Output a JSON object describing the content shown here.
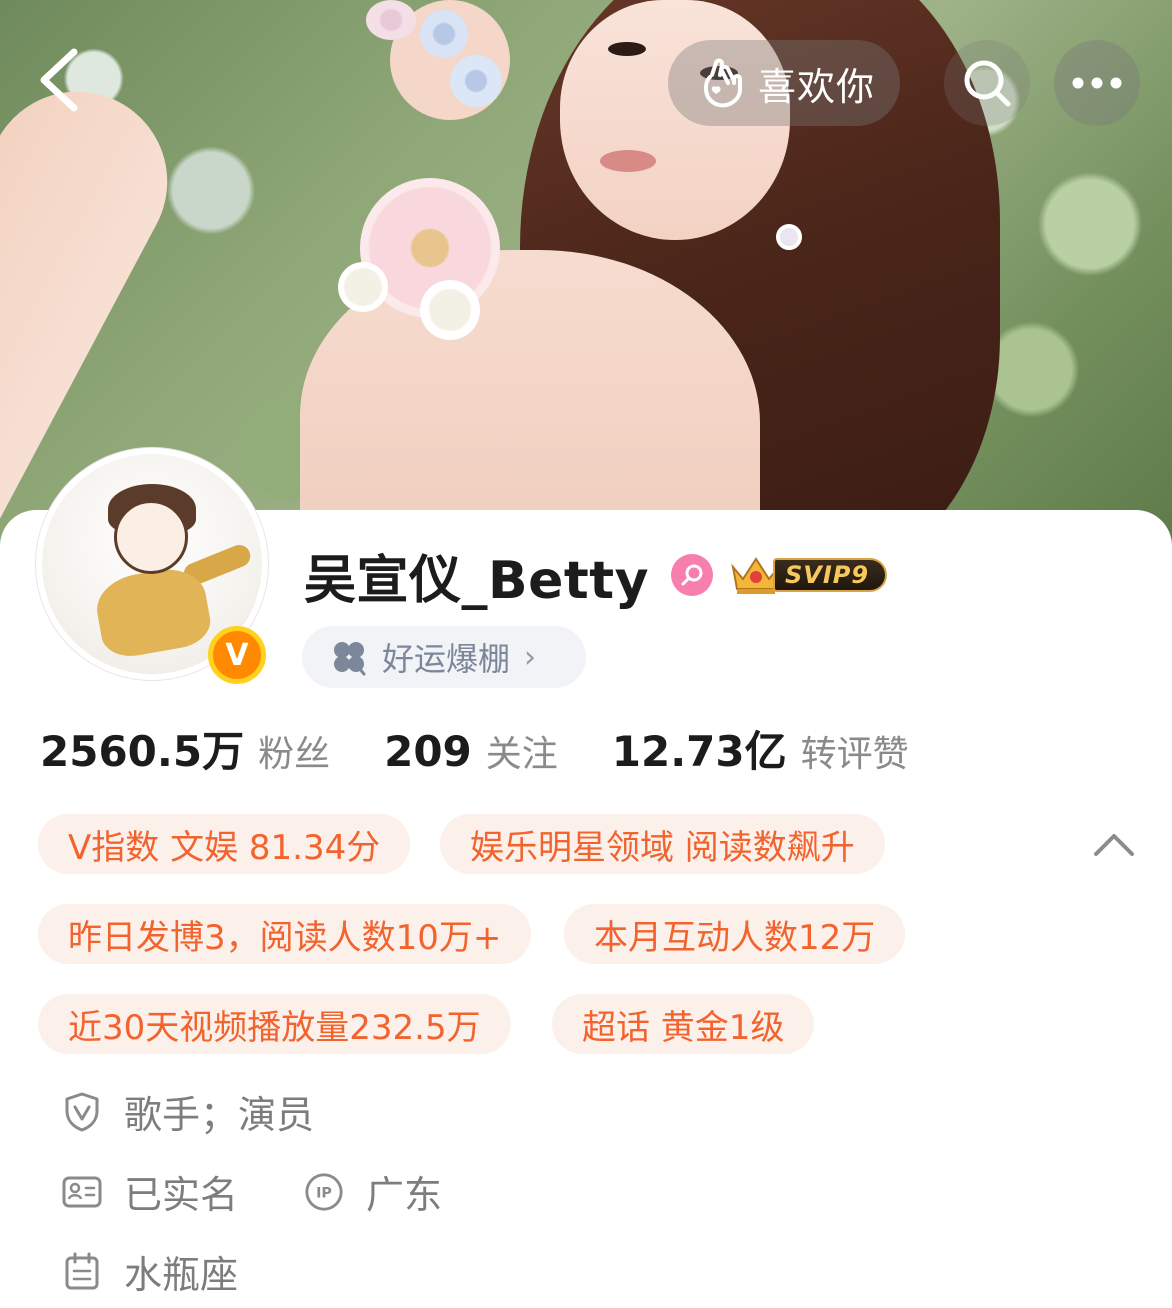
{
  "header": {
    "like_label": "喜欢你",
    "back_icon": "chevron-left-icon",
    "search_icon": "search-icon",
    "more_icon": "more-horizontal-icon"
  },
  "profile": {
    "name": "吴宣仪_Betty",
    "gender": "female",
    "svip_label": "SVIP9",
    "verified": "V",
    "luck_label": "好运爆棚",
    "colors": {
      "accent_orange": "#f2632e",
      "tag_bg": "#fcf0ea",
      "gender_pink": "#f77fae",
      "verified_orange": "#ff8a00"
    }
  },
  "stats": [
    {
      "value": "2560.5万",
      "label": "粉丝"
    },
    {
      "value": "209",
      "label": "关注"
    },
    {
      "value": "12.73亿",
      "label": "转评赞"
    }
  ],
  "tags": [
    "V指数 文娱 81.34分",
    "娱乐明星领域 阅读数飙升",
    "昨日发博3，阅读人数10万+",
    "本月互动人数12万",
    "近30天视频播放量232.5万",
    "超话 黄金1级"
  ],
  "info": {
    "occupation": "歌手；演员",
    "real_name": "已实名",
    "ip_location": "广东",
    "zodiac": "水瓶座"
  }
}
